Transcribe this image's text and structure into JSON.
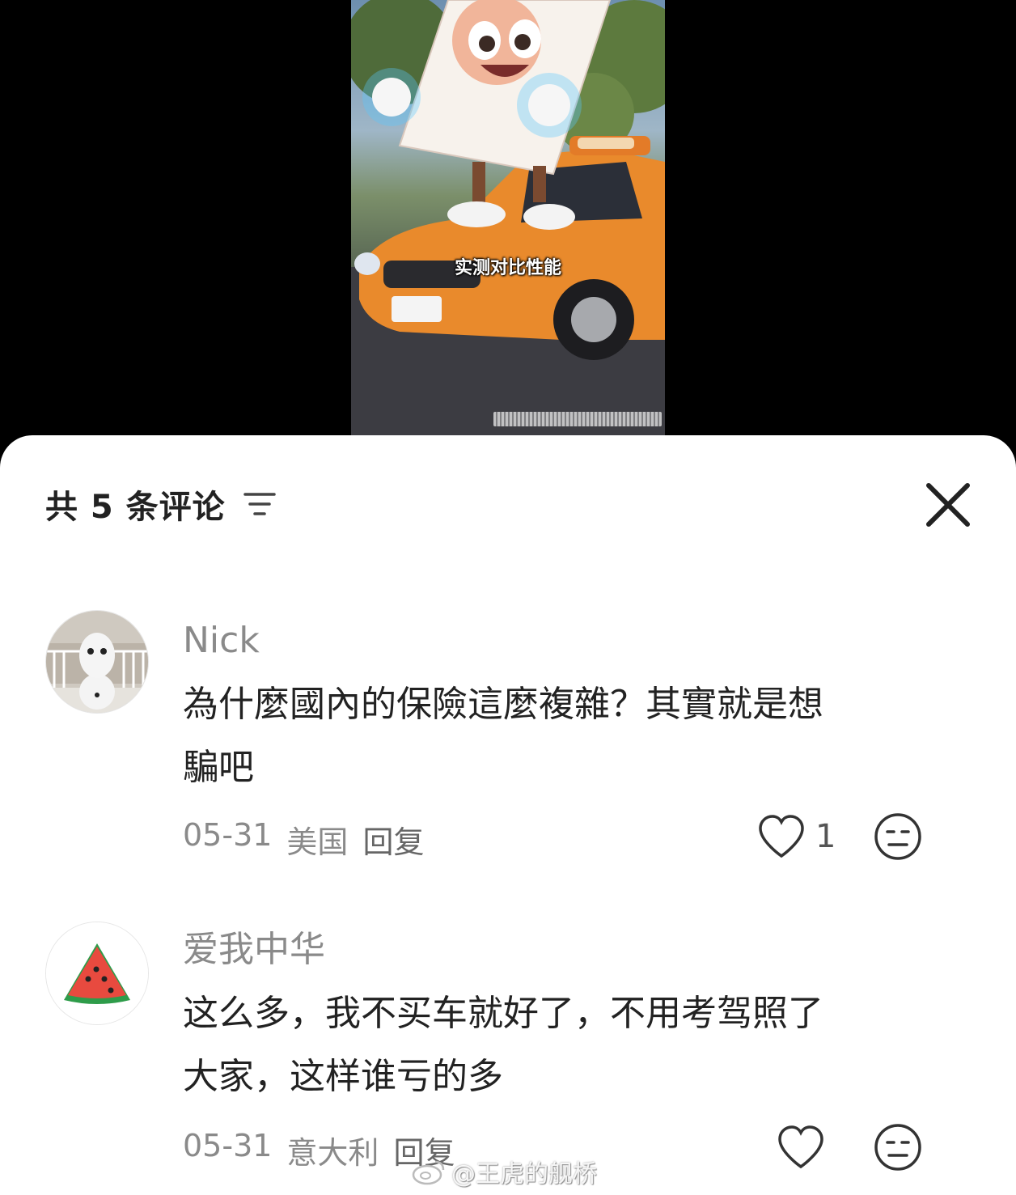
{
  "video": {
    "subtitle": "实测对比性能"
  },
  "comments_panel": {
    "title": "共 5 条评论",
    "comments": [
      {
        "user": "Nick",
        "text_line1": "為什麼國內的保險這麼複雜？其實就是想",
        "text_line2": "騙吧",
        "date": "05-31",
        "location": "美国",
        "reply_label": "回复",
        "likes": "1"
      },
      {
        "user": "爱我中华",
        "text_line1": "这么多，我不买车就好了，不用考驾照了",
        "text_line2": "大家，这样谁亏的多",
        "date": "05-31",
        "location": "意大利",
        "reply_label": "回复",
        "likes": ""
      }
    ]
  },
  "watermark": {
    "text": "@王虎的舰桥"
  }
}
